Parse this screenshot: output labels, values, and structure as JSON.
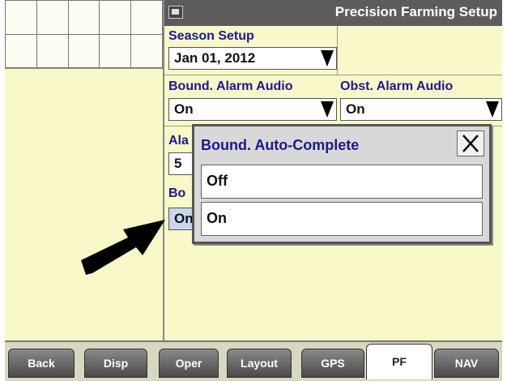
{
  "header": {
    "title": "Precision Farming Setup",
    "icon": "screen-icon"
  },
  "season": {
    "label": "Season Setup",
    "value": "Jan 01, 2012"
  },
  "bound_alarm": {
    "label": "Bound. Alarm Audio",
    "value": "On"
  },
  "obst_alarm": {
    "label": "Obst. Alarm Audio",
    "value": "On"
  },
  "partial": {
    "alarm_label": "Ala",
    "alarm_value": "5",
    "bound_label": "Bo",
    "bound_value": "On"
  },
  "modal": {
    "title": "Bound. Auto-Complete",
    "options": [
      "Off",
      "On"
    ]
  },
  "tabs": [
    "Back",
    "Disp",
    "Oper",
    "Layout",
    "GPS",
    "PF",
    "NAV"
  ],
  "active_tab": "PF"
}
